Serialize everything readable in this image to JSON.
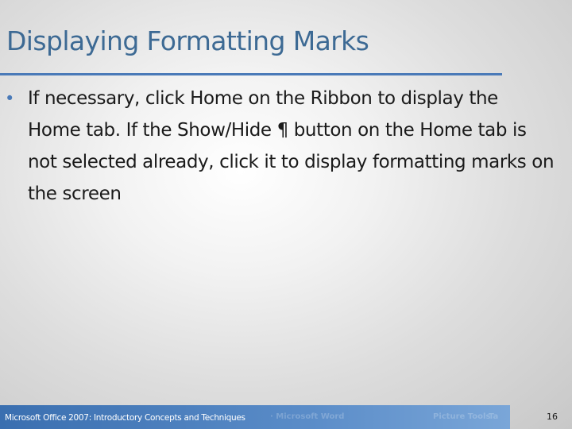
{
  "slide": {
    "title": "Displaying Formatting Marks",
    "bullets": [
      {
        "marker": "•",
        "text": "If necessary, click Home on the Ribbon to display the Home tab. If the Show/Hide ¶ button on the Home tab is not selected already, click it to display formatting marks on the screen"
      }
    ]
  },
  "footer": {
    "text": "Microsoft Office 2007: Introductory Concepts and Techniques",
    "page_number": "16",
    "bar_color": "#3a6fb0"
  },
  "colors": {
    "title": "#3d6a94",
    "rule": "#4a7ab8",
    "bullet": "#4a7ab8",
    "body_text": "#1a1a1a"
  }
}
